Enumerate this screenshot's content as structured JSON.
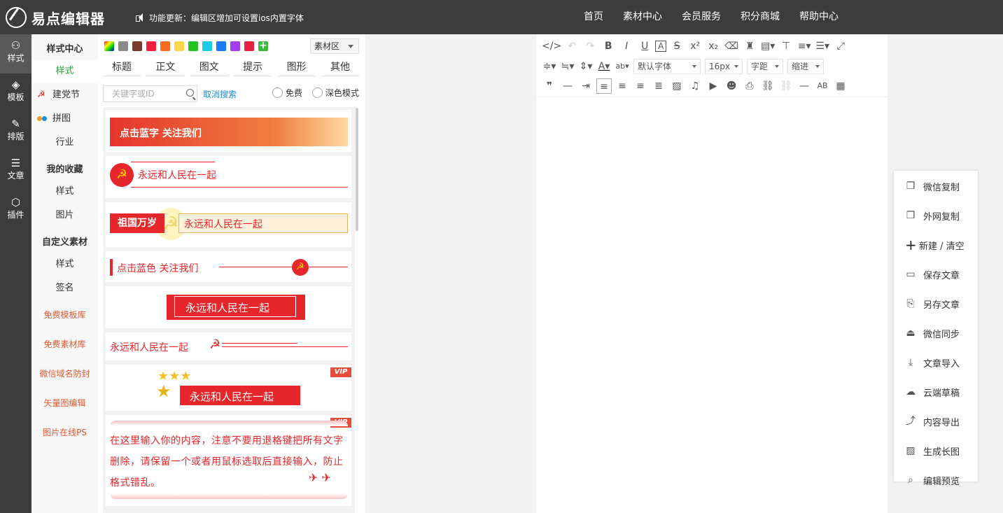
{
  "header": {
    "logo_text": "易点编辑器",
    "notice": "功能更新：编辑区增加可设置ios内置字体",
    "nav": [
      "首页",
      "素材中心",
      "会员服务",
      "积分商城",
      "帮助中心"
    ]
  },
  "rail": [
    {
      "label": "样式",
      "icon": "grid-icon",
      "glyph": "⚇"
    },
    {
      "label": "模板",
      "icon": "layers-icon",
      "glyph": "◈"
    },
    {
      "label": "排版",
      "icon": "edit-icon",
      "glyph": "✎"
    },
    {
      "label": "文章",
      "icon": "document-icon",
      "glyph": "☰"
    },
    {
      "label": "插件",
      "icon": "cube-icon",
      "glyph": "⬡"
    }
  ],
  "side": {
    "style_center": "样式中心",
    "style": "样式",
    "party": "建党节",
    "collage": "拼图",
    "industry": "行业",
    "favorites": "我的收藏",
    "fav_style": "样式",
    "fav_image": "图片",
    "custom": "自定义素材",
    "custom_style": "样式",
    "signature": "签名",
    "links": [
      "免费模板库",
      "免费素材库",
      "微信域名防封",
      "矢量图编辑",
      "图片在线PS"
    ]
  },
  "materials": {
    "colors": [
      "#8a8a8a",
      "#7a3b2e",
      "#f0203c",
      "#f56c1e",
      "#ffd54a",
      "#21c221",
      "#1ccbe8",
      "#1a7ef0",
      "#a43bf0",
      "#e52040"
    ],
    "area_select": "素材区",
    "tabs": [
      "标题",
      "正文",
      "图文",
      "提示",
      "图形",
      "其他"
    ],
    "search_placeholder": "关键字或ID",
    "cancel_search": "取消搜索",
    "free": "免费",
    "dark_mode": "深色模式",
    "cards": {
      "c1": "点击蓝字 关注我们",
      "c2": "永远和人民在一起",
      "c3_tag": "祖国万岁",
      "c3": "永远和人民在一起",
      "c4": "点击蓝色 关注我们",
      "c5": "永远和人民在一起",
      "c6": "永远和人民在一起",
      "c7": "永远和人民在一起",
      "c8": "在这里输入你的内容，注意不要用退格键把所有文字删除，请保留一个或者用鼠标选取后直接输入，防止格式错乱。",
      "vip": "VIP"
    }
  },
  "toolbar": {
    "font": "默认字体",
    "size": "16px",
    "spacing": "字距",
    "indent": "缩进"
  },
  "actions": [
    {
      "label": "微信复制",
      "icon": "copy-icon",
      "glyph": "❐"
    },
    {
      "label": "外网复制",
      "icon": "copy-outline-icon",
      "glyph": "❐"
    },
    {
      "label": "新建 / 清空",
      "icon": "plus-icon",
      "glyph": "+"
    },
    {
      "label": "保存文章",
      "icon": "save-icon",
      "glyph": "▭"
    },
    {
      "label": "另存文章",
      "icon": "save-as-icon",
      "glyph": "⎘"
    },
    {
      "label": "微信同步",
      "icon": "upload-icon",
      "glyph": "⏏"
    },
    {
      "label": "文章导入",
      "icon": "import-icon",
      "glyph": "⤓"
    },
    {
      "label": "云端草稿",
      "icon": "cloud-icon",
      "glyph": "☁"
    },
    {
      "label": "内容导出",
      "icon": "export-icon",
      "glyph": "⤴"
    },
    {
      "label": "生成长图",
      "icon": "image-icon",
      "glyph": "▨"
    },
    {
      "label": "编辑预览",
      "icon": "preview-icon",
      "glyph": "⌕"
    }
  ]
}
